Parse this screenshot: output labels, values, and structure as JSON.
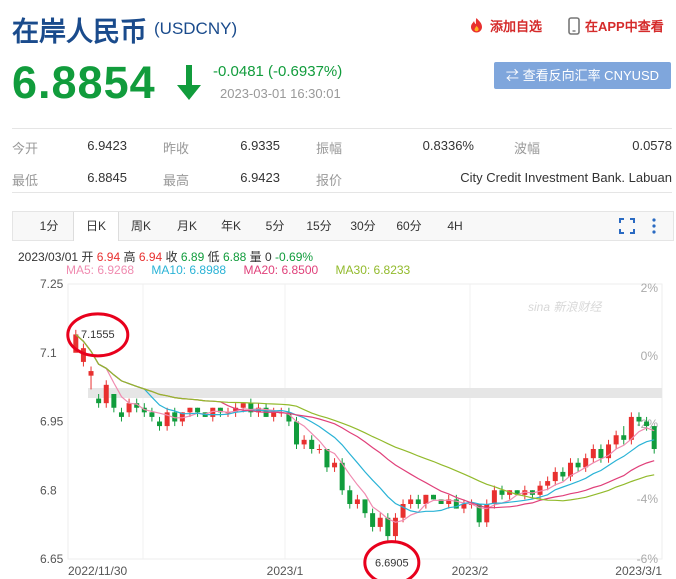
{
  "header": {
    "title": "在岸人民币",
    "code": "(USDCNY)",
    "add_favorite": "添加自选",
    "open_in_app": "在APP中查看"
  },
  "quote": {
    "price": "6.8854",
    "change": "-0.0481 (-0.6937%)",
    "time": "2023-03-01 16:30:01",
    "reverse_button": "查看反向汇率 CNYUSD",
    "color_down": "#119c3c"
  },
  "stats": [
    {
      "label": "今开",
      "value": "6.9423"
    },
    {
      "label": "昨收",
      "value": "6.9335"
    },
    {
      "label": "振幅",
      "value": "0.8336%"
    },
    {
      "label": "波幅",
      "value": "0.0578"
    },
    {
      "label": "最低",
      "value": "6.8845"
    },
    {
      "label": "最高",
      "value": "6.9423"
    },
    {
      "label": "报价",
      "value": "City Credit Investment Bank. Labuan"
    }
  ],
  "tabs": [
    "1分",
    "日K",
    "周K",
    "月K",
    "年K",
    "5分",
    "15分",
    "30分",
    "60分",
    "4H"
  ],
  "active_tab": "日K",
  "ohlc_bar": {
    "date": "2023/03/01",
    "open_label": "开",
    "open": "6.94",
    "high_label": "高",
    "high": "6.94",
    "close_label": "收",
    "close": "6.89",
    "low_label": "低",
    "low": "6.88",
    "vol_label": "量",
    "vol": "0",
    "pct": "-0.69%"
  },
  "ma_legend": [
    {
      "text": "MA5: 6.9268",
      "color": "#f08bb0"
    },
    {
      "text": "MA10: 6.8988",
      "color": "#2ab3d6"
    },
    {
      "text": "MA20: 6.8500",
      "color": "#e0407a"
    },
    {
      "text": "MA30: 6.8233",
      "color": "#92ba2c"
    }
  ],
  "icons": {
    "favorite": "flame-icon",
    "app": "phone-icon",
    "down": "arrow-down-icon",
    "swap": "swap-icon",
    "fullscreen": "fullscreen-icon",
    "more": "more-icon"
  },
  "chart_data": {
    "type": "candlestick",
    "y_ticks": [
      "7.25",
      "7.1",
      "6.95",
      "6.8",
      "6.65"
    ],
    "pct_ticks": [
      "2%",
      "0%",
      "-2%",
      "-4%",
      "-6%"
    ],
    "x_ticks": [
      "2022/11/30",
      "2023/1",
      "2023/2",
      "2023/3/1"
    ],
    "ylim": [
      6.65,
      7.25
    ],
    "annotations": [
      "7.1555",
      "6.6905"
    ],
    "watermark": "sina 新浪财经",
    "colors": {
      "up": "#e8302f",
      "down": "#119c3c"
    },
    "candles": [
      [
        7.1,
        7.14,
        7.11,
        7.15
      ],
      [
        7.08,
        7.11,
        7.07,
        7.12
      ],
      [
        7.05,
        7.06,
        7.02,
        7.07
      ],
      [
        7.0,
        6.99,
        6.98,
        7.01
      ],
      [
        6.99,
        7.03,
        6.98,
        7.04
      ],
      [
        7.01,
        6.98,
        6.97,
        7.01
      ],
      [
        6.97,
        6.96,
        6.95,
        6.98
      ],
      [
        6.97,
        6.99,
        6.96,
        7.0
      ],
      [
        6.99,
        6.98,
        6.97,
        7.0
      ],
      [
        6.98,
        6.97,
        6.96,
        6.99
      ],
      [
        6.97,
        6.96,
        6.95,
        6.98
      ],
      [
        6.95,
        6.94,
        6.93,
        6.96
      ],
      [
        6.94,
        6.97,
        6.93,
        6.98
      ],
      [
        6.97,
        6.95,
        6.94,
        6.98
      ],
      [
        6.95,
        6.97,
        6.94,
        6.97
      ],
      [
        6.97,
        6.98,
        6.96,
        6.98
      ],
      [
        6.98,
        6.97,
        6.96,
        6.98
      ],
      [
        6.97,
        6.96,
        6.96,
        6.97
      ],
      [
        6.96,
        6.98,
        6.95,
        6.98
      ],
      [
        6.98,
        6.97,
        6.96,
        6.98
      ],
      [
        6.97,
        6.97,
        6.96,
        6.98
      ],
      [
        6.97,
        6.98,
        6.96,
        6.99
      ],
      [
        6.98,
        6.99,
        6.97,
        6.99
      ],
      [
        6.99,
        6.97,
        6.96,
        7.0
      ],
      [
        6.97,
        6.98,
        6.96,
        6.99
      ],
      [
        6.98,
        6.96,
        6.96,
        6.99
      ],
      [
        6.96,
        6.97,
        6.95,
        6.98
      ],
      [
        6.97,
        6.97,
        6.96,
        6.98
      ],
      [
        6.97,
        6.95,
        6.94,
        6.98
      ],
      [
        6.95,
        6.9,
        6.89,
        6.96
      ],
      [
        6.9,
        6.91,
        6.89,
        6.92
      ],
      [
        6.91,
        6.89,
        6.88,
        6.92
      ],
      [
        6.89,
        6.89,
        6.88,
        6.9
      ],
      [
        6.89,
        6.85,
        6.84,
        6.89
      ],
      [
        6.85,
        6.86,
        6.84,
        6.87
      ],
      [
        6.86,
        6.8,
        6.79,
        6.87
      ],
      [
        6.8,
        6.77,
        6.76,
        6.81
      ],
      [
        6.77,
        6.78,
        6.76,
        6.79
      ],
      [
        6.78,
        6.75,
        6.74,
        6.78
      ],
      [
        6.75,
        6.72,
        6.71,
        6.76
      ],
      [
        6.72,
        6.74,
        6.71,
        6.75
      ],
      [
        6.74,
        6.7,
        6.69,
        6.75
      ],
      [
        6.7,
        6.74,
        6.69,
        6.75
      ],
      [
        6.74,
        6.77,
        6.73,
        6.78
      ],
      [
        6.77,
        6.78,
        6.76,
        6.79
      ],
      [
        6.78,
        6.77,
        6.76,
        6.79
      ],
      [
        6.77,
        6.79,
        6.76,
        6.79
      ],
      [
        6.79,
        6.78,
        6.78,
        6.79
      ],
      [
        6.78,
        6.77,
        6.77,
        6.78
      ],
      [
        6.77,
        6.78,
        6.76,
        6.79
      ],
      [
        6.78,
        6.76,
        6.76,
        6.79
      ],
      [
        6.76,
        6.77,
        6.75,
        6.78
      ],
      [
        6.77,
        6.77,
        6.76,
        6.78
      ],
      [
        6.77,
        6.73,
        6.72,
        6.77
      ],
      [
        6.73,
        6.77,
        6.72,
        6.78
      ],
      [
        6.77,
        6.8,
        6.76,
        6.81
      ],
      [
        6.8,
        6.79,
        6.78,
        6.81
      ],
      [
        6.79,
        6.8,
        6.78,
        6.8
      ],
      [
        6.8,
        6.79,
        6.79,
        6.8
      ],
      [
        6.79,
        6.8,
        6.78,
        6.81
      ],
      [
        6.8,
        6.79,
        6.78,
        6.8
      ],
      [
        6.79,
        6.81,
        6.78,
        6.82
      ],
      [
        6.81,
        6.82,
        6.8,
        6.83
      ],
      [
        6.82,
        6.84,
        6.81,
        6.85
      ],
      [
        6.84,
        6.83,
        6.82,
        6.85
      ],
      [
        6.83,
        6.86,
        6.82,
        6.87
      ],
      [
        6.86,
        6.85,
        6.84,
        6.87
      ],
      [
        6.85,
        6.87,
        6.84,
        6.88
      ],
      [
        6.87,
        6.89,
        6.86,
        6.9
      ],
      [
        6.89,
        6.87,
        6.86,
        6.9
      ],
      [
        6.87,
        6.9,
        6.86,
        6.91
      ],
      [
        6.9,
        6.92,
        6.89,
        6.93
      ],
      [
        6.92,
        6.91,
        6.9,
        6.94
      ],
      [
        6.91,
        6.96,
        6.9,
        6.97
      ],
      [
        6.96,
        6.95,
        6.94,
        6.97
      ],
      [
        6.95,
        6.94,
        6.93,
        6.96
      ],
      [
        6.94,
        6.89,
        6.88,
        6.94
      ]
    ],
    "ma_note": "moving averages computed from candle closes: MA5, MA10, MA20, MA30"
  }
}
